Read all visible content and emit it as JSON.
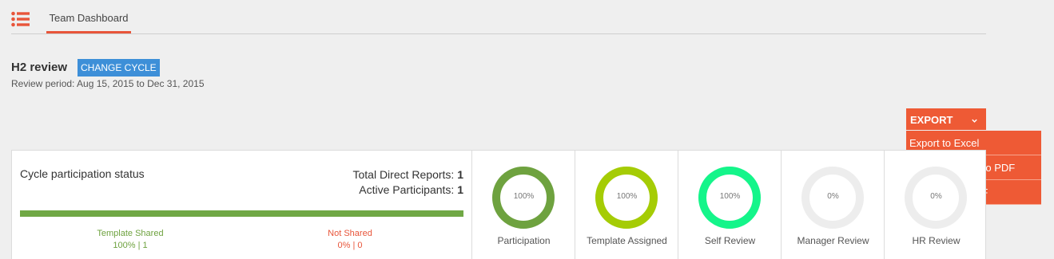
{
  "nav": {
    "menu_icon": "list-icon",
    "tab_label": "Team Dashboard"
  },
  "cycle": {
    "title": "H2 review",
    "change_label": "CHANGE CYCLE",
    "period": "Review period: Aug 15, 2015 to Dec 31, 2015"
  },
  "export": {
    "label": "EXPORT",
    "chevron_icon": "chevron-down-icon",
    "items": [
      "Export to Excel",
      "Select & export to PDF",
      "Export all to PDF"
    ]
  },
  "status": {
    "title": "Cycle participation status",
    "direct_reports_label": "Total Direct Reports: ",
    "direct_reports_value": "1",
    "active_label": "Active Participants: ",
    "active_value": "1",
    "shared_fraction": 1.0,
    "template_shared_label": "Template Shared",
    "template_shared_value": "100% | 1",
    "not_shared_label": "Not Shared",
    "not_shared_value": "0% | 0"
  },
  "metrics": [
    {
      "label": "Participation",
      "percent_text": "100%",
      "value": 1.0,
      "color": "#6ea23f"
    },
    {
      "label": "Template Assigned",
      "percent_text": "100%",
      "value": 1.0,
      "color": "#a5cc05"
    },
    {
      "label": "Self Review",
      "percent_text": "100%",
      "value": 1.0,
      "color": "#14f58a"
    },
    {
      "label": "Manager Review",
      "percent_text": "0%",
      "value": 0.0,
      "color": "#ededed"
    },
    {
      "label": "HR Review",
      "percent_text": "0%",
      "value": 0.0,
      "color": "#ededed"
    }
  ],
  "colors": {
    "accent": "#ee5a35",
    "link_blue": "#3d8fd8",
    "ring_track": "#ededed"
  }
}
